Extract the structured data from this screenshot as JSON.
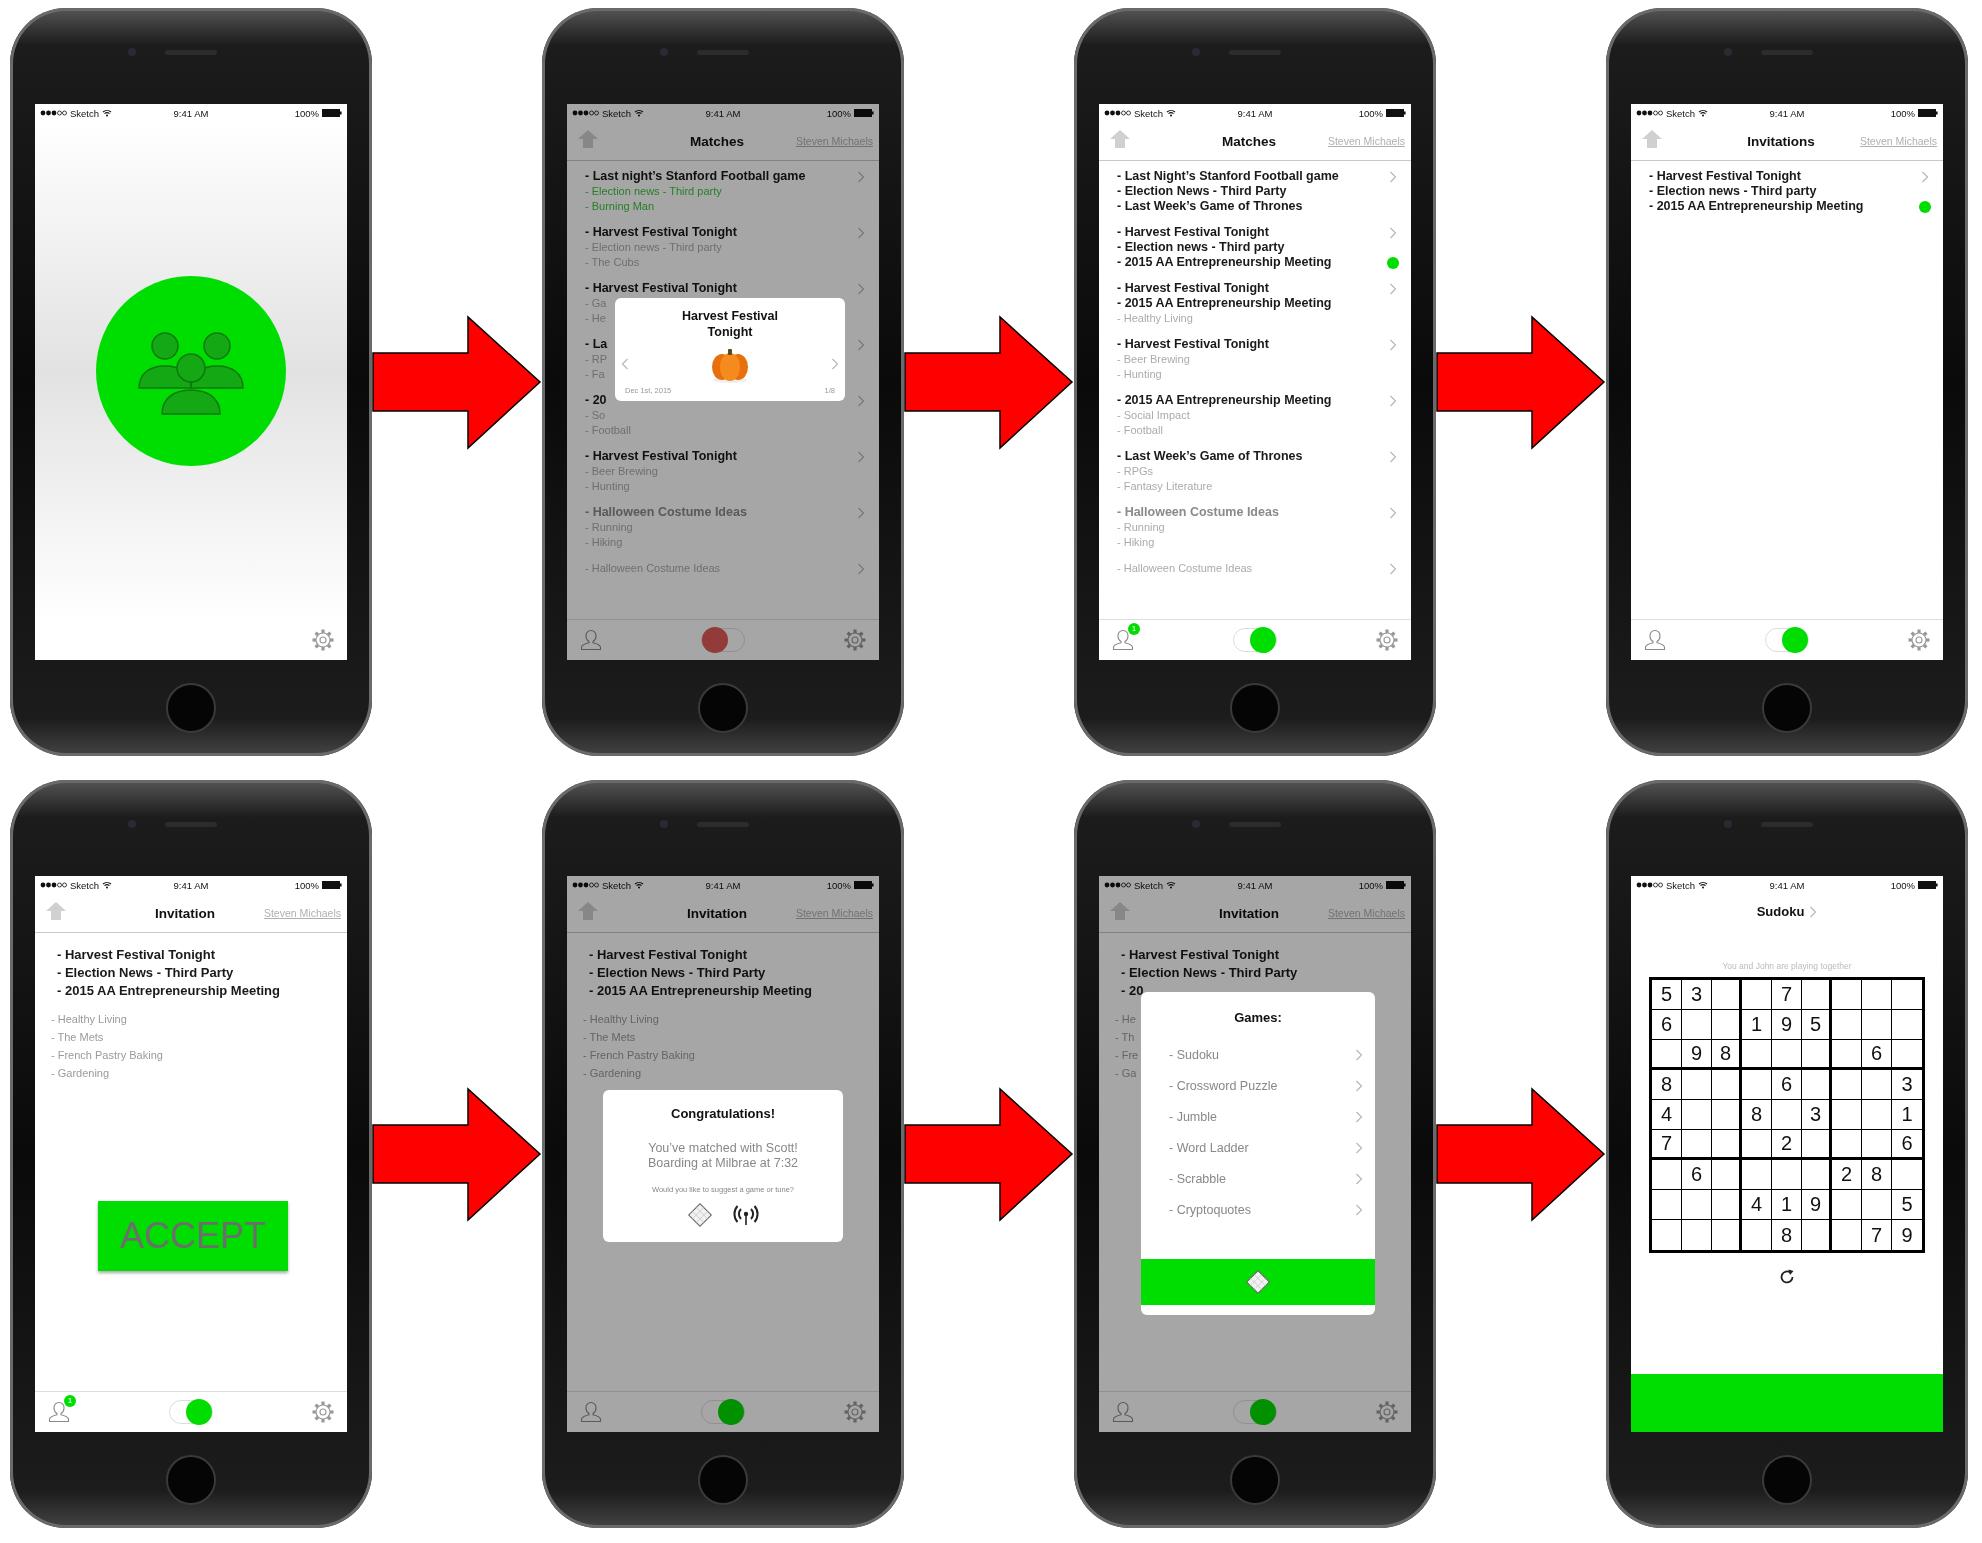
{
  "screens": [
    {
      "kind": "splash",
      "status_bar": {
        "carrier": "Sketch",
        "time": "9:41 AM",
        "battery": "100%"
      }
    },
    {
      "kind": "list",
      "dimmed": true,
      "status_bar": {
        "carrier": "Sketch",
        "time": "9:41 AM",
        "battery": "100%"
      },
      "nav": {
        "title": "Matches",
        "user": "Steven Michaels"
      },
      "items": [
        {
          "unread": false,
          "lines": [
            {
              "text": "- Last night’s Stanford Football game",
              "kind": "strong"
            },
            {
              "text": "- Election news - Third party",
              "kind": "green"
            },
            {
              "text": "- Burning Man",
              "kind": "green"
            }
          ]
        },
        {
          "unread": false,
          "lines": [
            {
              "text": "- Harvest Festival Tonight",
              "kind": "strong"
            },
            {
              "text": "- Election news - Third party",
              "kind": "faint"
            },
            {
              "text": "- The Cubs",
              "kind": "faint"
            }
          ]
        },
        {
          "unread": false,
          "lines": [
            {
              "text": "- Harvest Festival Tonight",
              "kind": "strong"
            },
            {
              "text": "- Ga",
              "kind": "faint"
            },
            {
              "text": "- He",
              "kind": "faint"
            }
          ]
        },
        {
          "unread": false,
          "lines": [
            {
              "text": "- La",
              "kind": "strong"
            },
            {
              "text": "- RP",
              "kind": "faint"
            },
            {
              "text": "- Fa",
              "kind": "faint"
            }
          ]
        },
        {
          "unread": false,
          "lines": [
            {
              "text": "- 20",
              "kind": "strong"
            },
            {
              "text": "- So",
              "kind": "faint"
            },
            {
              "text": "- Football",
              "kind": "faint"
            }
          ]
        },
        {
          "unread": false,
          "lines": [
            {
              "text": "- Harvest Festival Tonight",
              "kind": "strong"
            },
            {
              "text": "- Beer Brewing",
              "kind": "faint"
            },
            {
              "text": "- Hunting",
              "kind": "faint"
            }
          ]
        },
        {
          "unread": false,
          "lines": [
            {
              "text": "- Halloween Costume Ideas",
              "kind": "muted"
            },
            {
              "text": "- Running",
              "kind": "faint"
            },
            {
              "text": "- Hiking",
              "kind": "faint"
            }
          ]
        },
        {
          "unread": false,
          "lines": [
            {
              "text": "- Halloween Costume Ideas",
              "kind": "faint"
            }
          ]
        }
      ],
      "tab_bar": {
        "on": false
      },
      "overlay": {
        "kind": "event_card",
        "title": "Harvest Festival Tonight",
        "date": "Dec 1st, 2015",
        "counter": "1/8"
      }
    },
    {
      "kind": "list",
      "dimmed": false,
      "status_bar": {
        "carrier": "Sketch",
        "time": "9:41 AM",
        "battery": "100%"
      },
      "nav": {
        "title": "Matches",
        "user": "Steven Michaels"
      },
      "items": [
        {
          "unread": false,
          "lines": [
            {
              "text": "- Last Night’s Stanford Football game",
              "kind": "strong"
            },
            {
              "text": "- Election News - Third Party",
              "kind": "strong"
            },
            {
              "text": "- Last Week’s Game of Thrones",
              "kind": "strong"
            }
          ]
        },
        {
          "unread": true,
          "lines": [
            {
              "text": "- Harvest Festival Tonight",
              "kind": "strong"
            },
            {
              "text": "- Election news - Third party",
              "kind": "strong"
            },
            {
              "text": "- 2015 AA Entrepreneurship Meeting",
              "kind": "strong"
            }
          ]
        },
        {
          "unread": false,
          "lines": [
            {
              "text": "- Harvest Festival Tonight",
              "kind": "strong"
            },
            {
              "text": "- 2015 AA Entrepreneurship Meeting",
              "kind": "strong"
            },
            {
              "text": "- Healthy Living",
              "kind": "faint"
            }
          ]
        },
        {
          "unread": false,
          "lines": [
            {
              "text": "- Harvest Festival Tonight",
              "kind": "strong"
            },
            {
              "text": "- Beer Brewing",
              "kind": "faint"
            },
            {
              "text": "- Hunting",
              "kind": "faint"
            }
          ]
        },
        {
          "unread": false,
          "lines": [
            {
              "text": "- 2015 AA Entrepreneurship Meeting",
              "kind": "strong"
            },
            {
              "text": "- Social Impact",
              "kind": "faint"
            },
            {
              "text": "- Football",
              "kind": "faint"
            }
          ]
        },
        {
          "unread": false,
          "lines": [
            {
              "text": "- Last Week’s Game of Thrones",
              "kind": "strong"
            },
            {
              "text": "- RPGs",
              "kind": "faint"
            },
            {
              "text": "- Fantasy Literature",
              "kind": "faint"
            }
          ]
        },
        {
          "unread": false,
          "lines": [
            {
              "text": "- Halloween Costume Ideas",
              "kind": "muted"
            },
            {
              "text": "- Running",
              "kind": "faint"
            },
            {
              "text": "- Hiking",
              "kind": "faint"
            }
          ]
        },
        {
          "unread": false,
          "lines": [
            {
              "text": "- Halloween Costume Ideas",
              "kind": "faint"
            }
          ]
        }
      ],
      "tab_bar": {
        "badge": "1",
        "on": true
      }
    },
    {
      "kind": "list",
      "dimmed": false,
      "status_bar": {
        "carrier": "Sketch",
        "time": "9:41 AM",
        "battery": "100%"
      },
      "nav": {
        "title": "Invitations",
        "user": "Steven Michaels"
      },
      "items": [
        {
          "unread": true,
          "lines": [
            {
              "text": "- Harvest Festival Tonight",
              "kind": "strong"
            },
            {
              "text": "- Election news - Third party",
              "kind": "strong"
            },
            {
              "text": "- 2015 AA Entrepreneurship Meeting",
              "kind": "strong"
            }
          ]
        }
      ],
      "tab_bar": {
        "on": true
      }
    },
    {
      "kind": "invitation",
      "dimmed": false,
      "status_bar": {
        "carrier": "Sketch",
        "time": "9:41 AM",
        "battery": "100%"
      },
      "nav": {
        "title": "Invitation",
        "user": "Steven Michaels"
      },
      "headlines": [
        "- Harvest Festival Tonight",
        "- Election News - Third Party",
        "- 2015 AA Entrepreneurship Meeting"
      ],
      "topics": [
        "- Healthy Living",
        "- The Mets",
        "- French Pastry Baking",
        "- Gardening"
      ],
      "accept": "ACCEPT",
      "tab_bar": {
        "badge": "1",
        "on": true
      }
    },
    {
      "kind": "invitation",
      "dimmed": true,
      "status_bar": {
        "carrier": "Sketch",
        "time": "9:41 AM",
        "battery": "100%"
      },
      "nav": {
        "title": "Invitation",
        "user": "Steven Michaels"
      },
      "headlines": [
        "- Harvest Festival Tonight",
        "- Election News - Third Party",
        "- 2015 AA Entrepreneurship Meeting"
      ],
      "topics": [
        "- Healthy Living",
        "- The Mets",
        "- French Pastry Baking",
        "- Gardening"
      ],
      "tab_bar": {
        "on": true
      },
      "overlay": {
        "kind": "congrats",
        "title": "Congratulations!",
        "message": [
          "You’ve matched with Scott!",
          "Boarding at Milbrae at 7:32"
        ],
        "prompt": "Would you like to suggest a game or tune?"
      }
    },
    {
      "kind": "invitation",
      "dimmed": true,
      "status_bar": {
        "carrier": "Sketch",
        "time": "9:41 AM",
        "battery": "100%"
      },
      "nav": {
        "title": "Invitation",
        "user": "Steven Michaels"
      },
      "headlines": [
        "- Harvest Festival Tonight",
        "- Election News - Third Party",
        "- 20"
      ],
      "topics": [
        "- He",
        "- Th",
        "- Fre",
        "- Ga"
      ],
      "tab_bar": {
        "on": true
      },
      "overlay": {
        "kind": "games",
        "title": "Games:",
        "games": [
          "- Sudoku",
          "- Crossword Puzzle",
          "- Jumble",
          "- Word Ladder",
          "- Scrabble",
          "- Cryptoquotes"
        ]
      }
    },
    {
      "kind": "sudoku",
      "status_bar": {
        "carrier": "Sketch",
        "time": "9:41 AM",
        "battery": "100%"
      },
      "title": "Sudoku",
      "caption": "You and John are playing together",
      "grid": [
        [
          {
            "kind": "given",
            "value": "5"
          },
          {
            "kind": "given",
            "value": "3"
          },
          {
            "kind": "empty"
          },
          {
            "kind": "empty"
          },
          {
            "kind": "given",
            "value": "7"
          },
          {
            "kind": "empty"
          },
          {
            "kind": "empty"
          },
          {
            "kind": "empty"
          },
          {
            "kind": "empty"
          }
        ],
        [
          {
            "kind": "given",
            "value": "6"
          },
          {
            "kind": "empty"
          },
          {
            "kind": "empty"
          },
          {
            "kind": "given",
            "value": "1"
          },
          {
            "kind": "given",
            "value": "9"
          },
          {
            "kind": "given",
            "value": "5"
          },
          {
            "kind": "empty"
          },
          {
            "kind": "empty"
          },
          {
            "kind": "empty"
          }
        ],
        [
          {
            "kind": "empty"
          },
          {
            "kind": "given",
            "value": "9"
          },
          {
            "kind": "given",
            "value": "8"
          },
          {
            "kind": "empty"
          },
          {
            "kind": "empty"
          },
          {
            "kind": "empty"
          },
          {
            "kind": "empty"
          },
          {
            "kind": "given",
            "value": "6"
          },
          {
            "kind": "empty"
          }
        ],
        [
          {
            "kind": "given",
            "value": "8"
          },
          {
            "kind": "empty"
          },
          {
            "kind": "empty"
          },
          {
            "kind": "empty"
          },
          {
            "kind": "given",
            "value": "6"
          },
          {
            "kind": "empty"
          },
          {
            "kind": "empty"
          },
          {
            "kind": "empty"
          },
          {
            "kind": "given",
            "value": "3"
          }
        ],
        [
          {
            "kind": "given",
            "value": "4"
          },
          {
            "kind": "empty"
          },
          {
            "kind": "empty"
          },
          {
            "kind": "given",
            "value": "8"
          },
          {
            "kind": "empty"
          },
          {
            "kind": "given",
            "value": "3"
          },
          {
            "kind": "empty"
          },
          {
            "kind": "empty"
          },
          {
            "kind": "given",
            "value": "1"
          }
        ],
        [
          {
            "kind": "given",
            "value": "7"
          },
          {
            "kind": "empty"
          },
          {
            "kind": "empty"
          },
          {
            "kind": "empty"
          },
          {
            "kind": "given",
            "value": "2"
          },
          {
            "kind": "empty"
          },
          {
            "kind": "empty"
          },
          {
            "kind": "empty"
          },
          {
            "kind": "given",
            "value": "6"
          }
        ],
        [
          {
            "kind": "empty"
          },
          {
            "kind": "given",
            "value": "6"
          },
          {
            "kind": "empty"
          },
          {
            "kind": "empty"
          },
          {
            "kind": "empty"
          },
          {
            "kind": "empty"
          },
          {
            "kind": "given",
            "value": "2"
          },
          {
            "kind": "given",
            "value": "8"
          },
          {
            "kind": "empty"
          }
        ],
        [
          {
            "kind": "empty"
          },
          {
            "kind": "empty"
          },
          {
            "kind": "empty"
          },
          {
            "kind": "given",
            "value": "4"
          },
          {
            "kind": "given",
            "value": "1"
          },
          {
            "kind": "given",
            "value": "9"
          },
          {
            "kind": "empty"
          },
          {
            "kind": "empty"
          },
          {
            "kind": "given",
            "value": "5"
          }
        ],
        [
          {
            "kind": "empty"
          },
          {
            "kind": "empty"
          },
          {
            "kind": "empty"
          },
          {
            "kind": "empty"
          },
          {
            "kind": "given",
            "value": "8"
          },
          {
            "kind": "empty"
          },
          {
            "kind": "empty"
          },
          {
            "kind": "given",
            "value": "7"
          },
          {
            "kind": "given",
            "value": "9"
          }
        ]
      ]
    }
  ]
}
